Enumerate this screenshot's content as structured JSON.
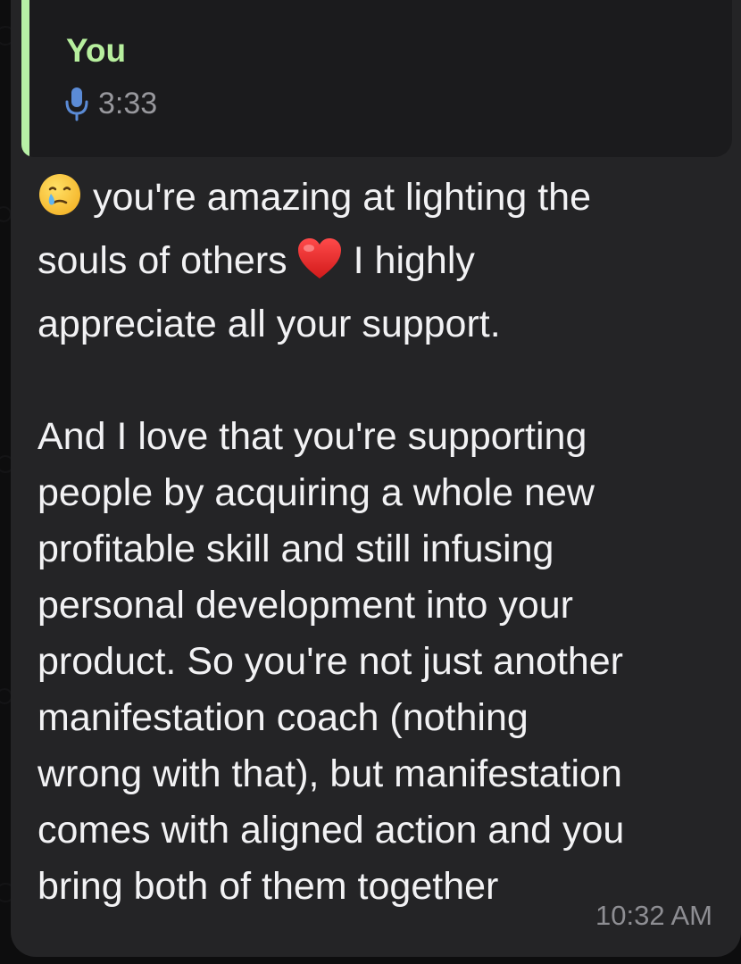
{
  "reply": {
    "sender": "You",
    "duration": "3:33"
  },
  "message": {
    "intro_a": "you're amazing at lighting the",
    "intro_b": "souls of others",
    "intro_c": "I highly\nappreciate all your support.",
    "body": "And I love that you're supporting\npeople by acquiring a whole new\nprofitable skill and still infusing\npersonal development into your\nproduct. So you're not just another\nmanifestation coach (nothing\nwrong with that), but manifestation\ncomes with aligned action and you\nbring both of them together",
    "timestamp": "10:32 AM"
  },
  "icons": {
    "emoji_1": "face-holding-back-tears-icon",
    "emoji_2": "red-heart-icon",
    "reply_icon": "microphone-icon"
  },
  "colors": {
    "reply_accent": "#b7f0a6",
    "mic": "#5b8bd6",
    "bubble": "#242426"
  }
}
